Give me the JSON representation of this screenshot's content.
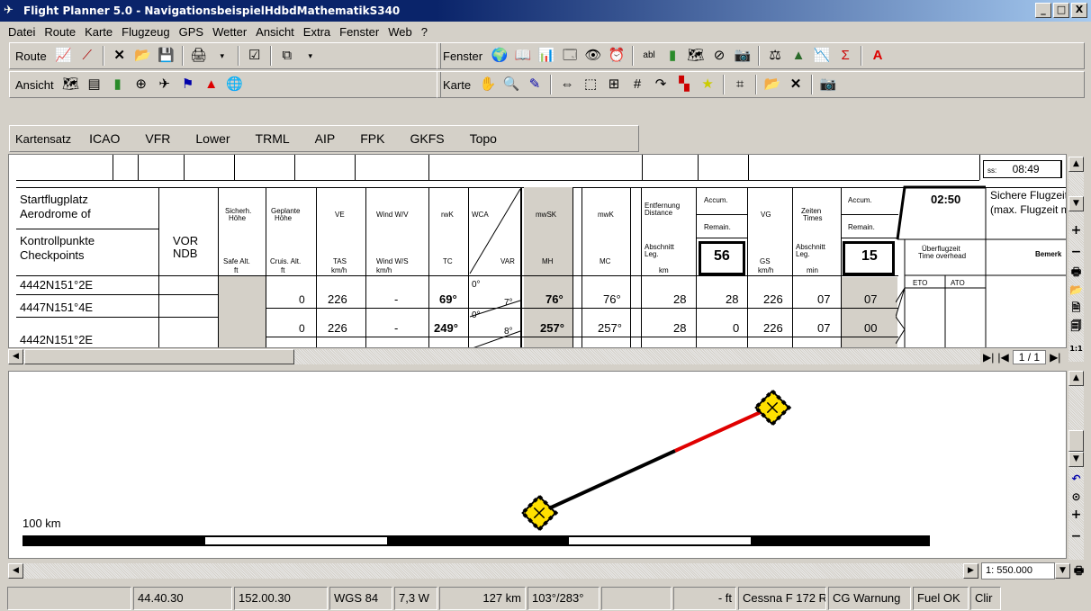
{
  "window": {
    "title": "Flight Planner 5.0 - NavigationsbeispielHdbdMathematikS340",
    "min": "_",
    "max": "□",
    "close": "X"
  },
  "menu": [
    "Datei",
    "Route",
    "Karte",
    "Flugzeug",
    "GPS",
    "Wetter",
    "Ansicht",
    "Extra",
    "Fenster",
    "Web",
    "?"
  ],
  "toolbars": {
    "route_label": "Route",
    "ansicht_label": "Ansicht",
    "fenster_label": "Fenster",
    "karte_label": "Karte",
    "kartensatz_label": "Kartensatz",
    "kartensatz_items": [
      "ICAO",
      "VFR",
      "Lower",
      "TRML",
      "AIP",
      "FPK",
      "GKFS",
      "Topo"
    ]
  },
  "log": {
    "time_value": "08:49",
    "time_prefix": "ss:",
    "headers": {
      "start": "Startflugplatz",
      "aero": "Aerodrome of",
      "kontroll": "Kontrollpunkte",
      "check": "Checkpoints",
      "vor": "VOR",
      "ndb": "NDB",
      "sicher": "Sicherh.",
      "hoehe": "Höhe",
      "safe": "Safe Alt.",
      "ft1": "ft",
      "geplante": "Geplante",
      "hoehe2": "Höhe",
      "cruis": "Cruis. Alt.",
      "ft2": "ft",
      "ve": "VE",
      "tas": "TAS",
      "kmh1": "km/h",
      "windwv": "Wind W/V",
      "windws": "Wind W/S",
      "kmh2": "km/h",
      "rwk": "rwK",
      "tc": "TC",
      "wca": "WCA",
      "var": "VAR",
      "mwsk": "mwSK",
      "mh": "MH",
      "mwk": "mwK",
      "mc": "MC",
      "entf": "Entfernung",
      "dist": "Distance",
      "abschn": "Abschnitt",
      "leg": "Leg.",
      "km": "km",
      "accum": "Accum.",
      "remain": "Remain.",
      "accum_val": "56",
      "vg": "VG",
      "gs": "GS",
      "kmh3": "km/h",
      "zeiten": "Zeiten",
      "times": "Times",
      "abschn2": "Abschnitt",
      "leg2": "Leg.",
      "min": "min",
      "accum2": "Accum.",
      "remain2": "Remain.",
      "accum2_val": "15",
      "safe_time": "02:50",
      "sichere": "Sichere Flugzeit",
      "maxflug": "(max. Flugzeit m",
      "ueberflug": "Überflugzeit",
      "overhead": "Time overhead",
      "eto": "ETO",
      "ato": "ATO",
      "bemerk": "Bemerk"
    },
    "rows": [
      {
        "name": "4442N151°2E",
        "cruis": "0",
        "tas": "226",
        "wind": "-",
        "tc": "69°",
        "wca": "0°",
        "var": "7°",
        "mh": "76°",
        "mc": "76°",
        "leg": "28",
        "acc": "28",
        "gs": "226",
        "min": "07",
        "acc2": "07"
      },
      {
        "name": "4447N151°4E",
        "cruis": "0",
        "tas": "226",
        "wind": "-",
        "tc": "249°",
        "wca": "0°",
        "var": "8°",
        "mh": "257°",
        "mc": "257°",
        "leg": "28",
        "acc": "0",
        "gs": "226",
        "min": "07",
        "acc2": "00"
      },
      {
        "name": "4442N151°2E"
      }
    ],
    "pager": "1 / 1"
  },
  "map": {
    "scale_label": "100 km",
    "scale_value": "1: 550.000"
  },
  "status": [
    "",
    "44.40.30",
    "152.00.30",
    "WGS 84",
    "7,3 W",
    "127 km",
    "103°/283°",
    "",
    "- ft",
    "Cessna F 172 R",
    "CG Warnung",
    "Fuel OK",
    "Clir"
  ]
}
